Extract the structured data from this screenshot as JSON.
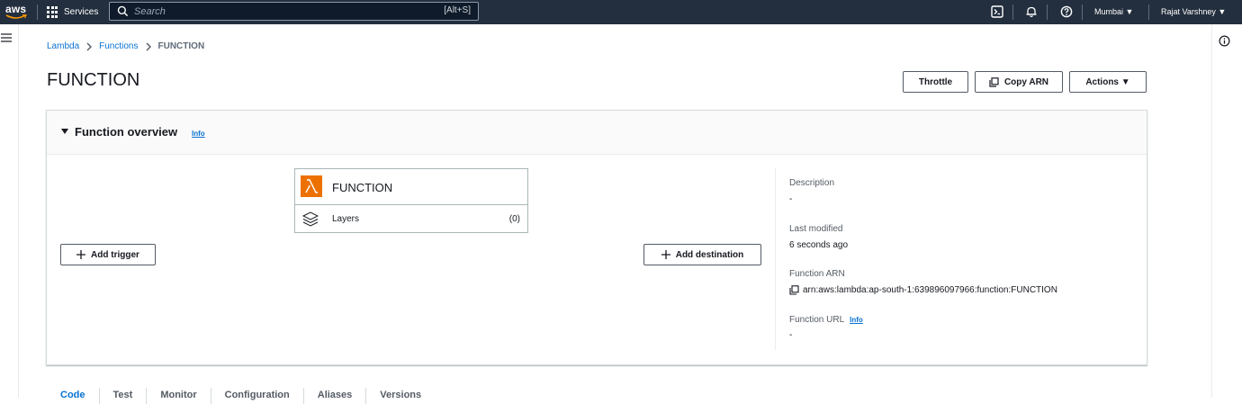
{
  "nav": {
    "logo": "aws",
    "services_label": "Services",
    "search_placeholder": "Search",
    "search_shortcut": "[Alt+S]",
    "region": "Mumbai ▼",
    "user": "Rajat Varshney ▼"
  },
  "breadcrumb": {
    "root": "Lambda",
    "functions": "Functions",
    "current": "FUNCTION"
  },
  "page_title": "FUNCTION",
  "buttons": {
    "throttle": "Throttle",
    "copy_arn": "Copy ARN",
    "actions": "Actions ▼"
  },
  "overview": {
    "title": "Function overview",
    "info": "Info",
    "function_name": "FUNCTION",
    "layers_label": "Layers",
    "layers_count": "(0)",
    "add_trigger": "Add trigger",
    "add_destination": "Add destination",
    "description_label": "Description",
    "description_value": "-",
    "last_modified_label": "Last modified",
    "last_modified_value": "6 seconds ago",
    "arn_label": "Function ARN",
    "arn_value": "arn:aws:lambda:ap-south-1:639896097966:function:FUNCTION",
    "url_label": "Function URL",
    "url_info": "Info",
    "url_value": "-"
  },
  "tabs": [
    "Code",
    "Test",
    "Monitor",
    "Configuration",
    "Aliases",
    "Versions"
  ],
  "colors": {
    "nav_bg": "#232f3e",
    "link": "#0972d3",
    "lambda_orange": "#ed7100"
  }
}
